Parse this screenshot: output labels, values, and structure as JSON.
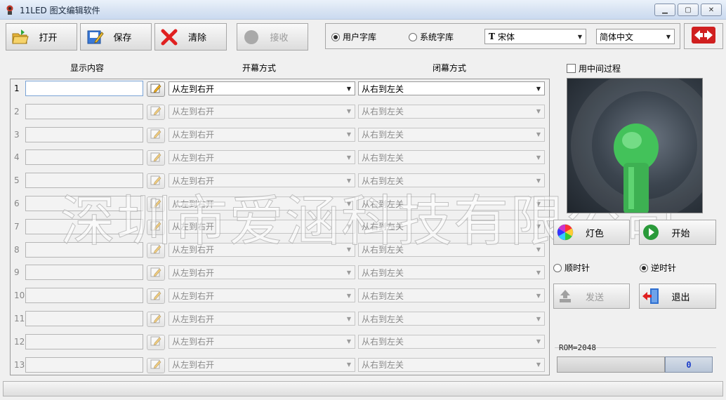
{
  "window": {
    "title": "11LED 图文编辑软件"
  },
  "toolbar": {
    "open_label": "打开",
    "save_label": "保存",
    "clear_label": "清除",
    "receive_label": "接收"
  },
  "font_source": {
    "user_label": "用户字库",
    "system_label": "系统字库",
    "selected": "user",
    "font_name": "宋体",
    "language": "简体中文"
  },
  "table": {
    "headers": {
      "content": "显示内容",
      "open_mode": "开幕方式",
      "close_mode": "闭幕方式"
    },
    "rows": [
      {
        "num": "1",
        "content": "",
        "open": "从左到右开",
        "close": "从右到左关",
        "active": true
      },
      {
        "num": "2",
        "content": "",
        "open": "从左到右开",
        "close": "从右到左关",
        "active": false
      },
      {
        "num": "3",
        "content": "",
        "open": "从左到右开",
        "close": "从右到左关",
        "active": false
      },
      {
        "num": "4",
        "content": "",
        "open": "从左到右开",
        "close": "从右到左关",
        "active": false
      },
      {
        "num": "5",
        "content": "",
        "open": "从左到右开",
        "close": "从右到左关",
        "active": false
      },
      {
        "num": "6",
        "content": "",
        "open": "从左到右开",
        "close": "从右到左关",
        "active": false
      },
      {
        "num": "7",
        "content": "",
        "open": "从左到右开",
        "close": "从右到左关",
        "active": false
      },
      {
        "num": "8",
        "content": "",
        "open": "从左到右开",
        "close": "从右到左关",
        "active": false
      },
      {
        "num": "9",
        "content": "",
        "open": "从左到右开",
        "close": "从右到左关",
        "active": false
      },
      {
        "num": "10",
        "content": "",
        "open": "从左到右开",
        "close": "从右到左关",
        "active": false
      },
      {
        "num": "11",
        "content": "",
        "open": "从左到右开",
        "close": "从右到左关",
        "active": false
      },
      {
        "num": "12",
        "content": "",
        "open": "从左到右开",
        "close": "从右到左关",
        "active": false
      },
      {
        "num": "13",
        "content": "",
        "open": "从左到右开",
        "close": "从右到左关",
        "active": false
      }
    ]
  },
  "watermark": "深圳市爱涵科技有限公司",
  "side": {
    "middle_process_label": "用中间过程",
    "middle_process_checked": false,
    "color_label": "灯色",
    "start_label": "开始",
    "clockwise_label": "顺时针",
    "counterclockwise_label": "逆时针",
    "rotation": "counterclockwise",
    "send_label": "发送",
    "exit_label": "退出",
    "rom_label": "ROM=2048",
    "progress_value": "0"
  },
  "colors": {
    "fan_green": "#43c25a",
    "accent_blue": "#1a3cc9"
  },
  "icons": [
    "app-icon",
    "open-folder-icon",
    "save-icon",
    "clear-icon",
    "receive-icon",
    "font-icon",
    "exit-app-icon",
    "edit-icon",
    "color-wheel-icon",
    "play-icon",
    "send-icon",
    "exit-door-icon"
  ]
}
